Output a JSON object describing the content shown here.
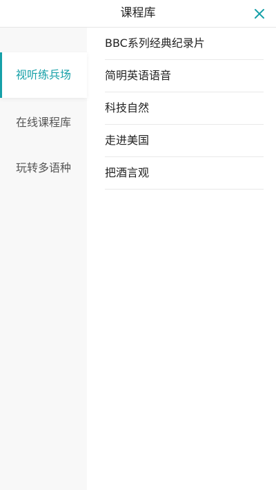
{
  "header": {
    "title": "课程库",
    "close_icon": "close-icon",
    "accent_color": "#16a0a8"
  },
  "sidebar": {
    "items": [
      {
        "label": "视听练兵场",
        "active": true
      },
      {
        "label": "在线课程库",
        "active": false
      },
      {
        "label": "玩转多语种",
        "active": false
      }
    ]
  },
  "list": {
    "items": [
      {
        "label": "BBC系列经典纪录片"
      },
      {
        "label": "简明英语语音"
      },
      {
        "label": "科技自然"
      },
      {
        "label": "走进美国"
      },
      {
        "label": "把酒言观"
      }
    ]
  }
}
